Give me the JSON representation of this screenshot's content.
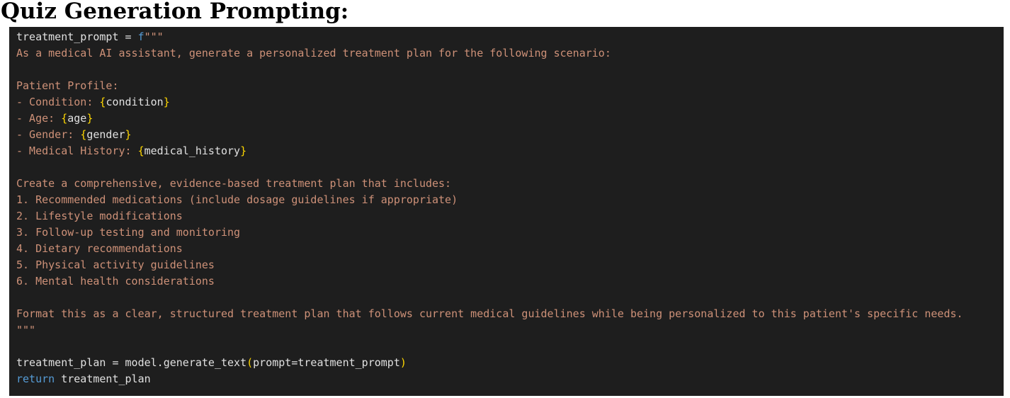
{
  "heading": "Quiz Generation Prompting:",
  "colors": {
    "editor_background": "#1e1e1e",
    "plain_text": "#d4d4d4",
    "keyword": "#569cd6",
    "string": "#ce9178",
    "brace": "#ffd700"
  },
  "code_lines": [
    {
      "tokens": [
        {
          "t": "ident",
          "v": "treatment_prompt = "
        },
        {
          "t": "kw",
          "v": "f"
        },
        {
          "t": "str",
          "v": "\"\"\""
        }
      ]
    },
    {
      "tokens": [
        {
          "t": "str",
          "v": "As a medical AI assistant, generate a personalized treatment plan for the following scenario:"
        }
      ]
    },
    {
      "tokens": []
    },
    {
      "tokens": [
        {
          "t": "str",
          "v": "Patient Profile:"
        }
      ]
    },
    {
      "tokens": [
        {
          "t": "str",
          "v": "- Condition: "
        },
        {
          "t": "brace",
          "v": "{"
        },
        {
          "t": "ident",
          "v": "condition"
        },
        {
          "t": "brace",
          "v": "}"
        }
      ]
    },
    {
      "tokens": [
        {
          "t": "str",
          "v": "- Age: "
        },
        {
          "t": "brace",
          "v": "{"
        },
        {
          "t": "ident",
          "v": "age"
        },
        {
          "t": "brace",
          "v": "}"
        }
      ]
    },
    {
      "tokens": [
        {
          "t": "str",
          "v": "- Gender: "
        },
        {
          "t": "brace",
          "v": "{"
        },
        {
          "t": "ident",
          "v": "gender"
        },
        {
          "t": "brace",
          "v": "}"
        }
      ]
    },
    {
      "tokens": [
        {
          "t": "str",
          "v": "- Medical History: "
        },
        {
          "t": "brace",
          "v": "{"
        },
        {
          "t": "ident",
          "v": "medical_history"
        },
        {
          "t": "brace",
          "v": "}"
        }
      ]
    },
    {
      "tokens": []
    },
    {
      "tokens": [
        {
          "t": "str",
          "v": "Create a comprehensive, evidence-based treatment plan that includes:"
        }
      ]
    },
    {
      "tokens": [
        {
          "t": "str",
          "v": "1. Recommended medications (include dosage guidelines if appropriate)"
        }
      ]
    },
    {
      "tokens": [
        {
          "t": "str",
          "v": "2. Lifestyle modifications"
        }
      ]
    },
    {
      "tokens": [
        {
          "t": "str",
          "v": "3. Follow-up testing and monitoring"
        }
      ]
    },
    {
      "tokens": [
        {
          "t": "str",
          "v": "4. Dietary recommendations"
        }
      ]
    },
    {
      "tokens": [
        {
          "t": "str",
          "v": "5. Physical activity guidelines"
        }
      ]
    },
    {
      "tokens": [
        {
          "t": "str",
          "v": "6. Mental health considerations"
        }
      ]
    },
    {
      "tokens": []
    },
    {
      "tokens": [
        {
          "t": "str",
          "v": "Format this as a clear, structured treatment plan that follows current medical guidelines while being personalized to this patient's specific needs."
        }
      ]
    },
    {
      "tokens": [
        {
          "t": "str",
          "v": "\"\"\""
        }
      ]
    },
    {
      "tokens": []
    },
    {
      "tokens": [
        {
          "t": "ident",
          "v": "treatment_plan = model.generate_text"
        },
        {
          "t": "brace",
          "v": "("
        },
        {
          "t": "ident",
          "v": "prompt=treatment_prompt"
        },
        {
          "t": "brace",
          "v": ")"
        }
      ]
    },
    {
      "tokens": [
        {
          "t": "kw",
          "v": "return"
        },
        {
          "t": "ident",
          "v": " treatment_plan"
        }
      ]
    }
  ]
}
